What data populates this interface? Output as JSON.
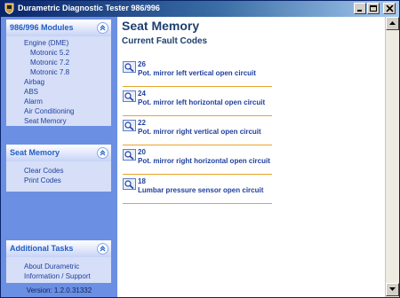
{
  "window": {
    "title": "Durametric Diagnostic Tester 986/996"
  },
  "sidebar": {
    "modules": {
      "title": "986/996 Modules",
      "items": [
        {
          "label": "Engine (DME)",
          "level": 1
        },
        {
          "label": "Motronic 5.2",
          "level": 2
        },
        {
          "label": "Motronic 7.2",
          "level": 2
        },
        {
          "label": "Motronic 7.8",
          "level": 2
        },
        {
          "label": "Airbag",
          "level": 1
        },
        {
          "label": "ABS",
          "level": 1
        },
        {
          "label": "Alarm",
          "level": 1
        },
        {
          "label": "Air Conditioning",
          "level": 1
        },
        {
          "label": "Seat Memory",
          "level": 1
        }
      ]
    },
    "seat_memory": {
      "title": "Seat Memory",
      "items": [
        {
          "label": "Clear Codes"
        },
        {
          "label": "Print Codes"
        }
      ]
    },
    "additional_tasks": {
      "title": "Additional Tasks",
      "items": [
        {
          "label": "About Durametric"
        },
        {
          "label": "Information / Support"
        }
      ]
    },
    "version": "Version: 1.2.0.31332"
  },
  "main": {
    "title": "Seat Memory",
    "subtitle": "Current Fault Codes",
    "faults": [
      {
        "code": "26",
        "description": "Pot. mirror left vertical open circuit"
      },
      {
        "code": "24",
        "description": "Pot. mirror left horizontal open circuit"
      },
      {
        "code": "22",
        "description": "Pot. mirror right vertical open circuit"
      },
      {
        "code": "20",
        "description": "Pot. mirror right horizontal open circuit"
      },
      {
        "code": "18",
        "description": "Lumbar pressure sensor open circuit"
      }
    ]
  },
  "colors": {
    "titlebar": "#0a246a",
    "sidebar_bg": "#6b8fe3",
    "panel_bg": "#d6dff7",
    "heading": "#1e3f6f",
    "link": "#1f3f9f",
    "separator": "#e7a42c"
  },
  "icons": {
    "app": "porsche-crest-icon",
    "collapse": "chevron-up-icon",
    "fault": "magnifier-icon"
  }
}
